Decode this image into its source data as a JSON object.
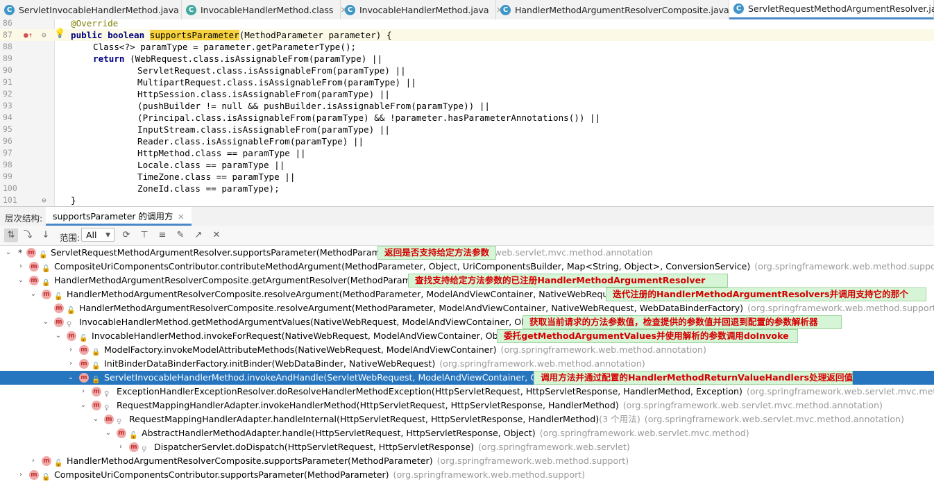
{
  "tabs": [
    {
      "label": "ServletInvocableHandlerMethod.java",
      "icon": "java-class-icon",
      "active": false
    },
    {
      "label": "InvocableHandlerMethod.class",
      "icon": "compiled-class-icon",
      "active": false
    },
    {
      "label": "InvocableHandlerMethod.java",
      "icon": "java-class-icon",
      "active": false
    },
    {
      "label": "HandlerMethodArgumentResolverComposite.java",
      "icon": "java-class-icon",
      "active": false
    },
    {
      "label": "ServletRequestMethodArgumentResolver.java",
      "icon": "java-class-icon",
      "active": true
    }
  ],
  "tab_close_glyph": "×",
  "editor": {
    "line_numbers": [
      "86",
      "87",
      "88",
      "89",
      "90",
      "91",
      "92",
      "93",
      "94",
      "95",
      "96",
      "97",
      "98",
      "99",
      "100",
      "101"
    ],
    "annotation": "@Override",
    "method_kw": "public boolean",
    "method_name": "supportsParameter",
    "method_sig": "(MethodParameter parameter) {",
    "l88": "Class<?> paramType = parameter.getParameterType();",
    "l89_kw": "return",
    "l89_rest": " (WebRequest.class.isAssignableFrom(paramType) ||",
    "l90": "ServletRequest.class.isAssignableFrom(paramType) ||",
    "l91": "MultipartRequest.class.isAssignableFrom(paramType) ||",
    "l92": "HttpSession.class.isAssignableFrom(paramType) ||",
    "l93": "(pushBuilder != null && pushBuilder.isAssignableFrom(paramType)) ||",
    "l94": "(Principal.class.isAssignableFrom(paramType) && !parameter.hasParameterAnnotations()) ||",
    "l95": "InputStream.class.isAssignableFrom(paramType) ||",
    "l96": "Reader.class.isAssignableFrom(paramType) ||",
    "l97": "HttpMethod.class == paramType ||",
    "l98": "Locale.class == paramType ||",
    "l99": "TimeZone.class == paramType ||",
    "l100": "ZoneId.class == paramType);",
    "l101": "}"
  },
  "panel": {
    "title": "层次结构:",
    "tab_label": "supportsParameter 的调用方",
    "scope_label": "范围:",
    "scope_value": "All"
  },
  "tree": [
    {
      "text": "ServletRequestMethodArgumentResolver.supportsParameter(MethodParameter)",
      "pkg": "rg.springframework.web.servlet.mvc.method.annotation",
      "note": "返回是否支持给定方法参数"
    },
    {
      "text": "CompositeUriComponentsContributor.contributeMethodArgument(MethodParameter, Object, UriComponentsBuilder, Map<String, Object>, ConversionService)",
      "pkg": "(org.springframework.web.method.support)",
      "note": ""
    },
    {
      "text": "HandlerMethodArgumentResolverComposite.getArgumentResolver(MethodParameter)",
      "pkg": "",
      "note": "查找支持给定方法参数的已注册HandlerMethodArgumentResolver"
    },
    {
      "text": "HandlerMethodArgumentResolverComposite.resolveArgument(MethodParameter, ModelAndViewContainer, NativeWebRequest, WebDataBinderFactory)",
      "pkg": "",
      "note": "迭代注册的HandlerMethodArgumentResolvers并调用支持它的那个"
    },
    {
      "text": "HandlerMethodArgumentResolverComposite.resolveArgument(MethodParameter, ModelAndViewContainer, NativeWebRequest, WebDataBinderFactory)",
      "pkg": "(org.springframework.web.method.support)",
      "note": ""
    },
    {
      "text": "InvocableHandlerMethod.getMethodArgumentValues(NativeWebRequest, ModelAndViewContainer, Object...)",
      "pkg": "",
      "note": "获取当前请求的方法参数值，检查提供的参数值并回退到配置的参数解析器"
    },
    {
      "text": "InvocableHandlerMethod.invokeForRequest(NativeWebRequest, ModelAndViewContainer, Object...)",
      "pkg": "",
      "note": "委托getMethodArgumentValues并使用解析的参数调用doInvoke"
    },
    {
      "text": "ModelFactory.invokeModelAttributeMethods(NativeWebRequest, ModelAndViewContainer)",
      "pkg": "(org.springframework.web.method.annotation)",
      "note": ""
    },
    {
      "text": "InitBinderDataBinderFactory.initBinder(WebDataBinder, NativeWebRequest)",
      "pkg": "(org.springframework.web.method.annotation)",
      "note": ""
    },
    {
      "text": "ServletInvocableHandlerMethod.invokeAndHandle(ServletWebRequest, ModelAndViewContainer, Object...)",
      "pkg": "",
      "note": "调用方法并通过配置的HandlerMethodReturnValueHandlers处理返回值"
    },
    {
      "text": "ExceptionHandlerExceptionResolver.doResolveHandlerMethodException(HttpServletRequest, HttpServletResponse, HandlerMethod, Exception)",
      "pkg": "(org.springframework.web.servlet.mvc.method.annotation)",
      "note": ""
    },
    {
      "text": "RequestMappingHandlerAdapter.invokeHandlerMethod(HttpServletRequest, HttpServletResponse, HandlerMethod)",
      "pkg": "(org.springframework.web.servlet.mvc.method.annotation)",
      "note": ""
    },
    {
      "text": "RequestMappingHandlerAdapter.handleInternal(HttpServletRequest, HttpServletResponse, HandlerMethod)",
      "pkg": "(org.springframework.web.servlet.mvc.method.annotation)",
      "usage": "(3 个用法)",
      "note": ""
    },
    {
      "text": "AbstractHandlerMethodAdapter.handle(HttpServletRequest, HttpServletResponse, Object)",
      "pkg": "(org.springframework.web.servlet.mvc.method)",
      "note": ""
    },
    {
      "text": "DispatcherServlet.doDispatch(HttpServletRequest, HttpServletResponse)",
      "pkg": "(org.springframework.web.servlet)",
      "note": ""
    },
    {
      "text": "HandlerMethodArgumentResolverComposite.supportsParameter(MethodParameter)",
      "pkg": "(org.springframework.web.method.support)",
      "note": ""
    },
    {
      "text": "CompositeUriComponentsContributor.supportsParameter(MethodParameter)",
      "pkg": "(org.springframework.web.method.support)",
      "note": ""
    }
  ],
  "colors": {
    "selection": "#2675bf",
    "note_bg": "#d6f5d6",
    "note_text": "#d40000",
    "keyword": "#000080",
    "highlight": "#f7d23e"
  }
}
